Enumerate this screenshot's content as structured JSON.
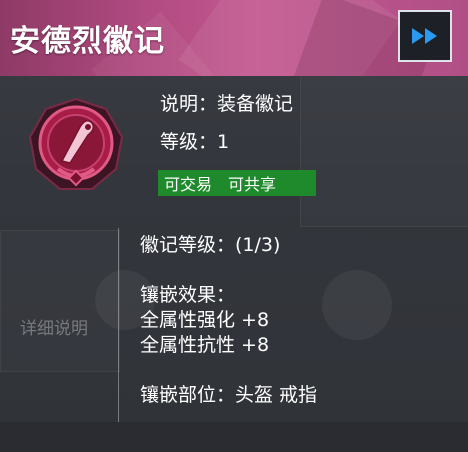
{
  "item": {
    "title": "安德烈徽记",
    "icon": "anchor-emblem-icon",
    "description": "说明：装备徽记",
    "level": "等级：1",
    "tags": [
      "可交易",
      "可共享"
    ]
  },
  "details": {
    "emblem_level": "徽记等级：(1/3)",
    "inlay_effect_heading": "镶嵌效果：",
    "effects": [
      "全属性强化 +8",
      "全属性抗性 +8"
    ],
    "inlay_slots": "镶嵌部位：头盔 戒指"
  },
  "sidebar": {
    "detail_label": "详细说明"
  },
  "header": {
    "fast_forward_icon": "fast-forward-icon"
  },
  "colors": {
    "header_pink": "#c3588f",
    "tag_green": "#1f8a2b",
    "emblem_crimson": "#b01e4a",
    "ff_blue": "#1e90ff"
  }
}
